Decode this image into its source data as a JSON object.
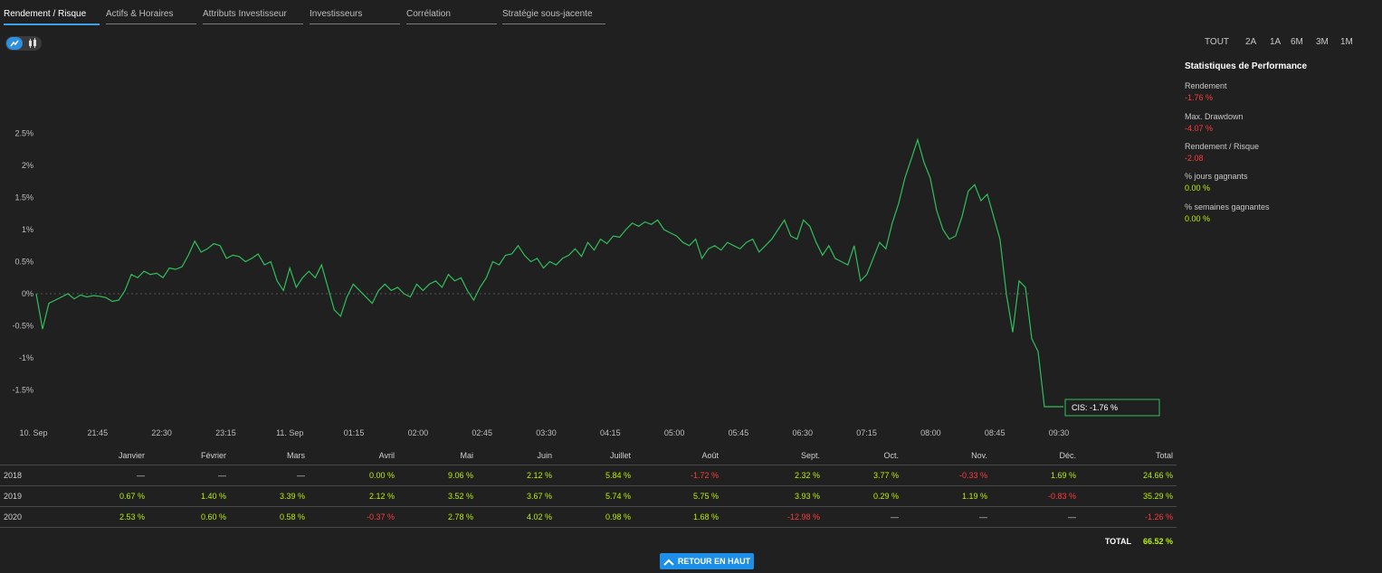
{
  "tabs": [
    {
      "label": "Rendement / Risque",
      "active": true
    },
    {
      "label": "Actifs & Horaires",
      "active": false
    },
    {
      "label": "Attributs Investisseur",
      "active": false
    },
    {
      "label": "Investisseurs",
      "active": false
    },
    {
      "label": "Corrélation",
      "active": false
    },
    {
      "label": "Stratégie sous-jacente",
      "active": false
    }
  ],
  "chart_toggle": {
    "selected": "line"
  },
  "ranges": [
    "TOUT",
    "2A",
    "1A",
    "6M",
    "3M",
    "1M"
  ],
  "stats": {
    "title": "Statistiques de Performance",
    "items": [
      {
        "label": "Rendement",
        "value": "-1.76 %",
        "tone": "neg"
      },
      {
        "label": "Max. Drawdown",
        "value": "-4.07 %",
        "tone": "neg"
      },
      {
        "label": "Rendement / Risque",
        "value": "-2.08",
        "tone": "neg"
      },
      {
        "label": "% jours gagnants",
        "value": "0.00 %",
        "tone": "pos"
      },
      {
        "label": "% semaines gagnantes",
        "value": "0.00 %",
        "tone": "pos"
      }
    ]
  },
  "chart_data": {
    "type": "line",
    "ylim": [
      -2.0,
      2.5
    ],
    "yticks": [
      2.5,
      2,
      1.5,
      1,
      0.5,
      0,
      -0.5,
      -1,
      -1.5
    ],
    "ytick_labels": [
      "2.5%",
      "2%",
      "1.5%",
      "1%",
      "0.5%",
      "0%",
      "-0.5%",
      "-1%",
      "-1.5%"
    ],
    "xtick_labels": [
      "10. Sep",
      "21:45",
      "22:30",
      "23:15",
      "11. Sep",
      "01:15",
      "02:00",
      "02:45",
      "03:30",
      "04:15",
      "05:00",
      "05:45",
      "06:30",
      "07:15",
      "08:00",
      "08:45",
      "09:30"
    ],
    "line_color": "#2fbf5a",
    "series": [
      {
        "values": [
          0,
          -0.55,
          -0.15,
          -0.1,
          -0.05,
          0.0,
          -0.08,
          -0.02,
          -0.05,
          -0.03,
          -0.04,
          -0.06,
          -0.12,
          -0.1,
          0.05,
          0.3,
          0.25,
          0.35,
          0.3,
          0.32,
          0.25,
          0.4,
          0.38,
          0.42,
          0.6,
          0.82,
          0.65,
          0.7,
          0.78,
          0.75,
          0.55,
          0.6,
          0.58,
          0.5,
          0.55,
          0.62,
          0.45,
          0.5,
          0.2,
          0.05,
          0.4,
          0.1,
          0.25,
          0.35,
          0.25,
          0.45,
          0.1,
          -0.25,
          -0.35,
          -0.05,
          0.15,
          0.05,
          -0.05,
          -0.15,
          0.05,
          0.15,
          0.05,
          0.1,
          0.0,
          -0.05,
          0.15,
          0.05,
          0.15,
          0.2,
          0.1,
          0.3,
          0.2,
          0.25,
          0.05,
          -0.1,
          0.1,
          0.25,
          0.5,
          0.45,
          0.6,
          0.62,
          0.75,
          0.6,
          0.5,
          0.55,
          0.4,
          0.5,
          0.45,
          0.55,
          0.6,
          0.7,
          0.58,
          0.8,
          0.68,
          0.85,
          0.78,
          0.9,
          0.88,
          1.0,
          1.1,
          1.05,
          1.12,
          1.08,
          1.15,
          1.0,
          0.95,
          0.9,
          0.8,
          0.75,
          0.85,
          0.55,
          0.7,
          0.75,
          0.68,
          0.8,
          0.75,
          0.7,
          0.8,
          0.85,
          0.65,
          0.75,
          0.85,
          1.0,
          1.15,
          0.9,
          0.85,
          1.15,
          1.05,
          0.8,
          0.6,
          0.75,
          0.55,
          0.5,
          0.45,
          0.75,
          0.2,
          0.3,
          0.55,
          0.8,
          0.7,
          1.1,
          1.4,
          1.8,
          2.1,
          2.4,
          2.05,
          1.8,
          1.3,
          1.0,
          0.85,
          0.9,
          1.2,
          1.6,
          1.7,
          1.45,
          1.55,
          1.2,
          0.85,
          0.0,
          -0.6,
          0.2,
          0.1,
          -0.7,
          -0.9,
          -1.76,
          -1.76,
          -1.76,
          -1.76
        ]
      }
    ],
    "tooltip": {
      "label": "CIS: -1.76 %"
    }
  },
  "table": {
    "months": [
      "Janvier",
      "Février",
      "Mars",
      "Avril",
      "Mai",
      "Juin",
      "Juillet",
      "Août",
      "Sept.",
      "Oct.",
      "Nov.",
      "Déc.",
      "Total"
    ],
    "rows": [
      {
        "year": "2018",
        "values": [
          "—",
          "—",
          "—",
          "0.00 %",
          "9.06 %",
          "2.12 %",
          "5.84 %",
          "-1.72 %",
          "2.32 %",
          "3.77 %",
          "-0.33 %",
          "1.69 %",
          "24.66 %"
        ]
      },
      {
        "year": "2019",
        "values": [
          "0.67 %",
          "1.40 %",
          "3.39 %",
          "2.12 %",
          "3.52 %",
          "3.67 %",
          "5.74 %",
          "5.75 %",
          "3.93 %",
          "0.29 %",
          "1.19 %",
          "-0.83 %",
          "35.29 %"
        ]
      },
      {
        "year": "2020",
        "values": [
          "2.53 %",
          "0.60 %",
          "0.58 %",
          "-0.37 %",
          "2.78 %",
          "4.02 %",
          "0.98 %",
          "1.68 %",
          "-12.98 %",
          "—",
          "—",
          "—",
          "-1.26 %"
        ]
      }
    ],
    "total_label": "TOTAL",
    "total_value": "66.52 %"
  },
  "back_button": {
    "label": "RETOUR EN HAUT"
  }
}
